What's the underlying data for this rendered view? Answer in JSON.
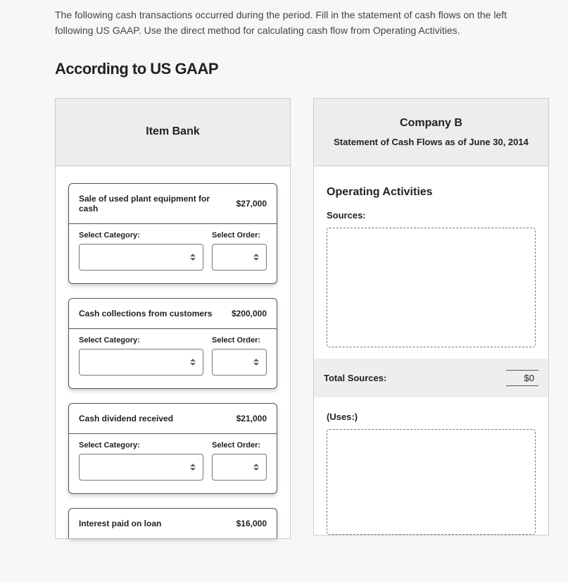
{
  "intro": "The following cash transactions occurred during the period. Fill in the statement of cash flows on the left following US GAAP. Use the direct method for calculating cash flow from Operating Activities.",
  "main_heading": "According to US GAAP",
  "item_bank": {
    "title": "Item Bank",
    "select_category_label": "Select Category:",
    "select_order_label": "Select Order:",
    "items": [
      {
        "desc": "Sale of used plant equipment for cash",
        "amount": "$27,000"
      },
      {
        "desc": "Cash collections from customers",
        "amount": "$200,000"
      },
      {
        "desc": "Cash dividend received",
        "amount": "$21,000"
      },
      {
        "desc": "Interest paid on loan",
        "amount": "$16,000"
      }
    ]
  },
  "statement": {
    "company": "Company B",
    "subtitle": "Statement of Cash Flows as of June 30, 2014",
    "sections": {
      "operating": {
        "heading": "Operating Activities",
        "sources_label": "Sources:",
        "total_sources_label": "Total Sources:",
        "total_sources_value": "$0",
        "uses_label": "(Uses:)"
      }
    }
  }
}
